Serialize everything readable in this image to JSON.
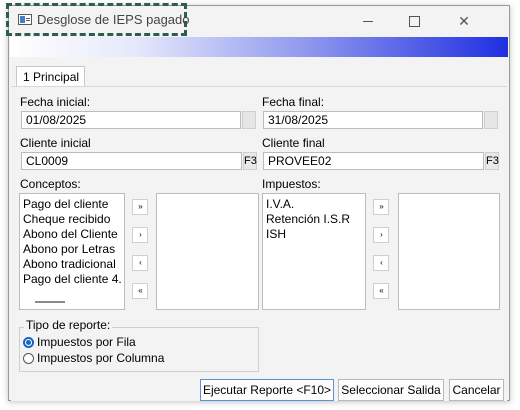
{
  "window": {
    "title": "Desglose de IEPS pagado",
    "controls": {
      "minimize": "",
      "maximize": "",
      "close": "✕"
    }
  },
  "tabs": [
    {
      "label": "1 Principal",
      "active": true
    }
  ],
  "form": {
    "fecha_inicial": {
      "label": "Fecha inicial:",
      "value": "01/08/2025"
    },
    "fecha_final": {
      "label": "Fecha final:",
      "value": "31/08/2025"
    },
    "cliente_inicial": {
      "label": "Cliente inicial",
      "value": "CL0009",
      "lookup": "F3"
    },
    "cliente_final": {
      "label": "Cliente final",
      "value": "PROVEE02",
      "lookup": "F3"
    },
    "conceptos": {
      "label": "Conceptos:",
      "available": [
        "Pago del cliente",
        "Cheque recibido",
        "Abono del Cliente",
        "Abono por Letras",
        "Abono tradicional",
        "Pago del cliente 4."
      ],
      "selected": []
    },
    "impuestos": {
      "label": "Impuestos:",
      "available": [
        "I.V.A.",
        "Retención I.S.R",
        "ISH"
      ],
      "selected": []
    },
    "move_buttons": [
      "»",
      "›",
      "‹",
      "«"
    ],
    "tipo_reporte": {
      "label": "Tipo de reporte:",
      "options": [
        {
          "label": "Impuestos por Fila",
          "checked": true
        },
        {
          "label": "Impuestos por Columna",
          "checked": false
        }
      ]
    }
  },
  "footer": {
    "run_label": "Ejecutar Reporte <F10>",
    "select_label": "Seleccionar Salida",
    "cancel_label": "Cancelar"
  },
  "colors": {
    "gradient_end": "#1f2fe2",
    "radio_accent": "#1565c0",
    "highlight_border": "#2e5d4f"
  }
}
